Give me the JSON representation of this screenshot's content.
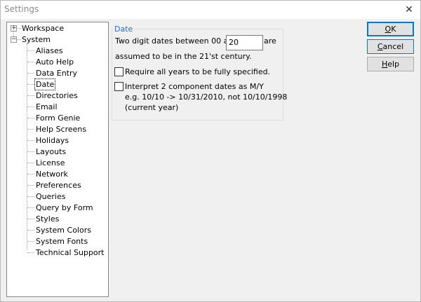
{
  "window": {
    "title": "Settings",
    "close_glyph": "✕"
  },
  "tree": {
    "roots": [
      {
        "label": "Workspace",
        "expander": "+"
      },
      {
        "label": "System",
        "expander": "−"
      }
    ],
    "children": [
      "Aliases",
      "Auto Help",
      "Data Entry",
      "Date",
      "Directories",
      "Email",
      "Form Genie",
      "Help Screens",
      "Holidays",
      "Layouts",
      "License",
      "Network",
      "Preferences",
      "Queries",
      "Query by Form",
      "Styles",
      "System Colors",
      "System Fonts",
      "Technical Support"
    ],
    "selected": "Date"
  },
  "date_group": {
    "title": "Date",
    "line1_before": "Two digit dates between 00 and",
    "year_value": "20",
    "line1_after": "are",
    "line2": "assumed to be in the 21'st century.",
    "require_all_years_label": "Require all years to be fully specified.",
    "require_all_years_checked": false,
    "interpret_label": "Interpret 2 component dates as M/Y",
    "interpret_checked": false,
    "example_line1": "e.g. 10/10 -> 10/31/2010, not 10/10/1998",
    "example_line2": "(current year)"
  },
  "buttons": {
    "ok": {
      "accel": "O",
      "rest": "K"
    },
    "cancel": {
      "accel": "C",
      "rest": "ancel"
    },
    "help": {
      "accel": "H",
      "rest": "elp"
    }
  }
}
